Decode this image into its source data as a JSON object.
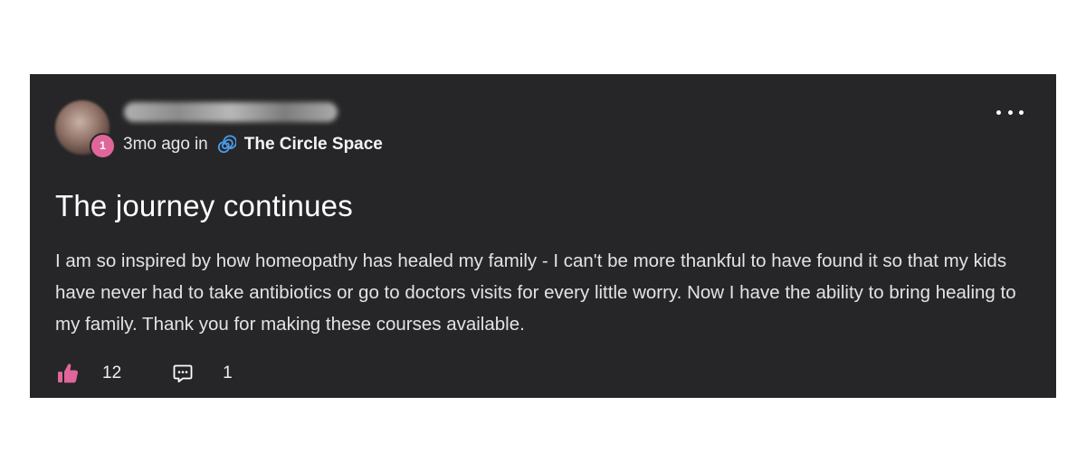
{
  "post": {
    "author": {
      "avatar_icon": "user-avatar",
      "level_badge": "1"
    },
    "meta": {
      "time": "3mo ago",
      "in_label": "in",
      "space_icon": "spiral-icon",
      "space_name": "The Circle Space"
    },
    "more_icon": "more-horizontal-icon",
    "title": "The journey continues",
    "body": "I am so inspired by how homeopathy has healed my family - I can't be more thankful to have found it so that my kids have never had to take antibiotics or go to doctors visits for every little worry. Now I have the ability to bring healing to my family. Thank you for making these courses available.",
    "actions": {
      "like_icon": "thumbs-up-icon",
      "like_count": "12",
      "comment_icon": "comment-icon",
      "comment_count": "1"
    }
  },
  "colors": {
    "card_background": "#262628",
    "accent_pink": "#e0669a",
    "space_icon_blue": "#4a9de8",
    "text_primary": "#ffffff"
  }
}
